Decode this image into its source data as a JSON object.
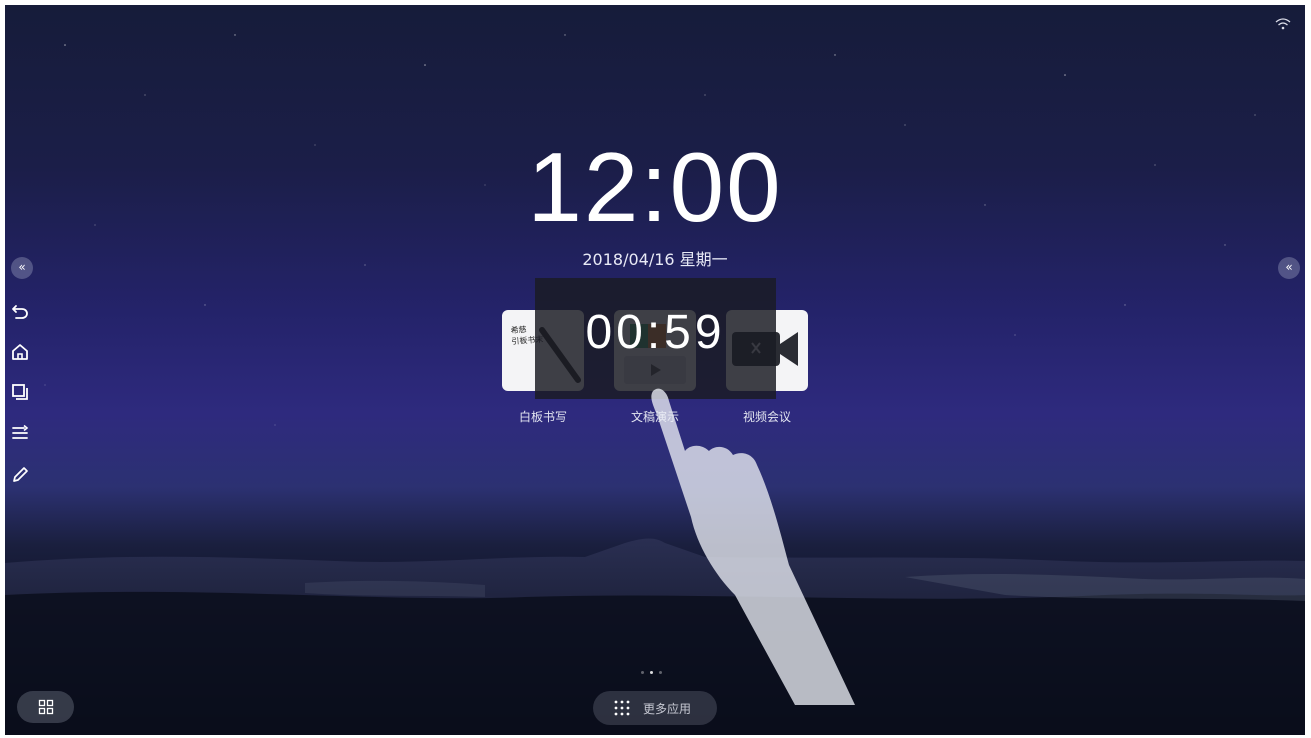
{
  "status_bar": {
    "wifi_icon": "wifi-icon"
  },
  "clock": {
    "time": "12:00",
    "date": "2018/04/16  星期一"
  },
  "timer": {
    "value": "00:59"
  },
  "apps": [
    {
      "label": "白板书写",
      "icon": "whiteboard-icon",
      "sample_text_line1": "希慈",
      "sample_text_line2": "引板书末"
    },
    {
      "label": "文稿演示",
      "icon": "presentation-icon"
    },
    {
      "label": "视频会议",
      "icon": "video-conference-icon"
    }
  ],
  "left_toolbar": {
    "collapse_icon": "«",
    "tools": [
      "back-icon",
      "home-icon",
      "windows-icon",
      "list-icon",
      "pen-icon"
    ]
  },
  "right_toolbar": {
    "collapse_icon": "«"
  },
  "bottom_bar": {
    "windows_icon": "windows-icon",
    "more_apps_label": "更多应用",
    "page_indicator": {
      "count": 3,
      "active": 1
    }
  },
  "colors": {
    "sky_top": "#161c3a",
    "sky_glow": "#2e2a7e",
    "ground": "#05080f"
  }
}
